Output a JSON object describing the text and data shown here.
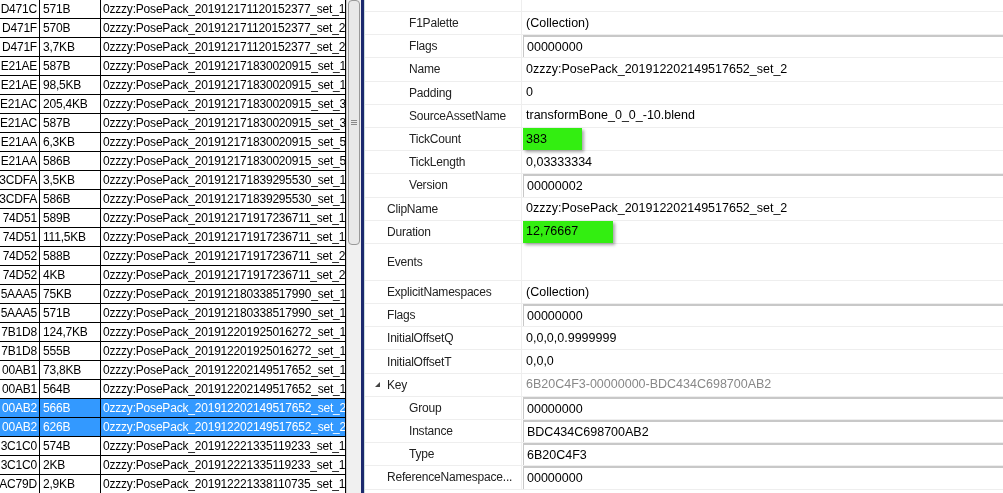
{
  "file_table": {
    "rows": [
      {
        "id": "D471C",
        "size": "571B",
        "name": "0zzzy:PosePack_201912171120152377_set_1",
        "selected": false
      },
      {
        "id": "D471F",
        "size": "570B",
        "name": "0zzzy:PosePack_201912171120152377_set_2",
        "selected": false
      },
      {
        "id": "D471F",
        "size": "3,7KB",
        "name": "0zzzy:PosePack_201912171120152377_set_2",
        "selected": false
      },
      {
        "id": "E21AE",
        "size": "587B",
        "name": "0zzzy:PosePack_201912171830020915_set_1",
        "selected": false
      },
      {
        "id": "E21AE",
        "size": "98,5KB",
        "name": "0zzzy:PosePack_201912171830020915_set_1",
        "selected": false
      },
      {
        "id": "E21AC",
        "size": "205,4KB",
        "name": "0zzzy:PosePack_201912171830020915_set_3",
        "selected": false
      },
      {
        "id": "E21AC",
        "size": "587B",
        "name": "0zzzy:PosePack_201912171830020915_set_3",
        "selected": false
      },
      {
        "id": "E21AA",
        "size": "6,3KB",
        "name": "0zzzy:PosePack_201912171830020915_set_5",
        "selected": false
      },
      {
        "id": "E21AA",
        "size": "586B",
        "name": "0zzzy:PosePack_201912171830020915_set_5",
        "selected": false
      },
      {
        "id": "3CDFA",
        "size": "3,5KB",
        "name": "0zzzy:PosePack_201912171839295530_set_1",
        "selected": false
      },
      {
        "id": "3CDFA",
        "size": "586B",
        "name": "0zzzy:PosePack_201912171839295530_set_1",
        "selected": false
      },
      {
        "id": "74D51",
        "size": "589B",
        "name": "0zzzy:PosePack_201912171917236711_set_1",
        "selected": false
      },
      {
        "id": "74D51",
        "size": "111,5KB",
        "name": "0zzzy:PosePack_201912171917236711_set_1",
        "selected": false
      },
      {
        "id": "74D52",
        "size": "588B",
        "name": "0zzzy:PosePack_201912171917236711_set_2",
        "selected": false
      },
      {
        "id": "74D52",
        "size": "4KB",
        "name": "0zzzy:PosePack_201912171917236711_set_2",
        "selected": false
      },
      {
        "id": "5AAA5",
        "size": "75KB",
        "name": "0zzzy:PosePack_201912180338517990_set_1",
        "selected": false
      },
      {
        "id": "5AAA5",
        "size": "571B",
        "name": "0zzzy:PosePack_201912180338517990_set_1",
        "selected": false
      },
      {
        "id": "7B1D8",
        "size": "124,7KB",
        "name": "0zzzy:PosePack_201912201925016272_set_1",
        "selected": false
      },
      {
        "id": "7B1D8",
        "size": "555B",
        "name": "0zzzy:PosePack_201912201925016272_set_1",
        "selected": false
      },
      {
        "id": "00AB1",
        "size": "73,8KB",
        "name": "0zzzy:PosePack_201912202149517652_set_1",
        "selected": false
      },
      {
        "id": "00AB1",
        "size": "564B",
        "name": "0zzzy:PosePack_201912202149517652_set_1",
        "selected": false
      },
      {
        "id": "00AB2",
        "size": "566B",
        "name": "0zzzy:PosePack_201912202149517652_set_2",
        "selected": true
      },
      {
        "id": "00AB2",
        "size": "626B",
        "name": "0zzzy:PosePack_201912202149517652_set_2",
        "selected": true
      },
      {
        "id": "3C1C0",
        "size": "574B",
        "name": "0zzzy:PosePack_201912221335119233_set_1",
        "selected": false
      },
      {
        "id": "3C1C0",
        "size": "2KB",
        "name": "0zzzy:PosePack_201912221335119233_set_1",
        "selected": false
      },
      {
        "id": "AC79D",
        "size": "2,9KB",
        "name": "0zzzy:PosePack_201912221338110735_set_1",
        "selected": false
      }
    ]
  },
  "properties": [
    {
      "children": [
        {
          "label": "F1Palette",
          "value": "(Collection)",
          "boxed": false,
          "highlighted": false
        },
        {
          "label": "Flags",
          "value": "00000000",
          "boxed": true,
          "highlighted": false
        },
        {
          "label": "Name",
          "value": "0zzzy:PosePack_201912202149517652_set_2",
          "boxed": false,
          "highlighted": false
        },
        {
          "label": "Padding",
          "value": "0",
          "boxed": false,
          "highlighted": false
        },
        {
          "label": "SourceAssetName",
          "value": "transformBone_0_0_-10.blend",
          "boxed": false,
          "highlighted": false
        },
        {
          "label": "TickCount",
          "value": "383",
          "boxed": false,
          "highlighted": true
        },
        {
          "label": "TickLength",
          "value": "0,03333334",
          "boxed": false,
          "highlighted": false
        },
        {
          "label": "Version",
          "value": "00000002",
          "boxed": true,
          "highlighted": false
        }
      ]
    },
    {
      "label": "ClipName",
      "value": "0zzzy:PosePack_201912202149517652_set_2",
      "boxed": false,
      "highlighted": false
    },
    {
      "label": "Duration",
      "value": "12,76667",
      "boxed": false,
      "highlighted": true
    },
    {
      "label": "Events",
      "boxed": false,
      "highlighted": false
    },
    {
      "label": "ExplicitNamespaces",
      "value": "(Collection)",
      "boxed": false,
      "highlighted": false
    },
    {
      "label": "Flags",
      "value": "00000000",
      "boxed": true,
      "highlighted": false
    },
    {
      "label": "InitialOffsetQ",
      "value": "0,0,0,0.9999999",
      "boxed": false,
      "highlighted": false
    },
    {
      "label": "InitialOffsetT",
      "value": "0,0,0",
      "boxed": false,
      "highlighted": false
    },
    {
      "label": "Key",
      "value": "6B20C4F3-00000000-BDC434C698700AB2",
      "boxed": false,
      "highlighted": false,
      "expanded": true,
      "disabled": true,
      "children": [
        {
          "label": "Group",
          "value": "00000000",
          "boxed": true,
          "highlighted": false
        },
        {
          "label": "Instance",
          "value": "BDC434C698700AB2",
          "boxed": true,
          "highlighted": false
        },
        {
          "label": "Type",
          "value": "6B20C4F3",
          "boxed": true,
          "highlighted": false
        }
      ]
    },
    {
      "label": "ReferenceNamespace...",
      "value": "00000000",
      "boxed": true,
      "highlighted": false
    }
  ]
}
